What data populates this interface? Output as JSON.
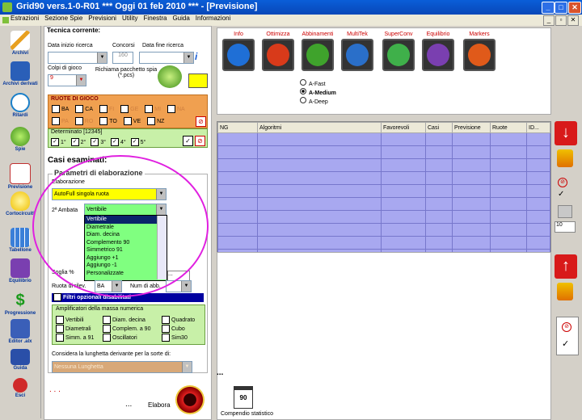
{
  "window": {
    "title": "Grid90 vers.1-0-R01  ***  Oggi 01 feb 2010  ***  - [Previsione]",
    "min_label": "_",
    "max_label": "□",
    "close_label": "✕"
  },
  "menu": {
    "items": [
      "Estrazioni",
      "Sezione Spie",
      "Previsioni",
      "Utility",
      "Finestra",
      "Guida",
      "Informazioni"
    ]
  },
  "toolbar": {
    "items": [
      "Archivi",
      "Archivi derivati",
      "Ritardi",
      "Spie",
      "Previsione",
      "Cortocircuiti",
      "Tabellone",
      "Equilibrio",
      "Progressione",
      "Editor .alx",
      "Guida",
      "Esci"
    ]
  },
  "tecnica": {
    "title": "Tecnica corrente:",
    "data_inizio_label": "Data inizio ricerca",
    "concorsi_label": "Concorsi",
    "concorsi_value": "160",
    "data_fine_label": "Data fine ricerca",
    "colpi_label": "Colpi di gioco",
    "colpi_value": "9",
    "richiama_label": "Richiama pacchetto spia (*.pcs)",
    "ruote_title": "RUOTE DI GIOCO",
    "ruote_row1": [
      "BA",
      "CA",
      "FI",
      "GE",
      "MI",
      "NA"
    ],
    "ruote_row2": [
      "PA",
      "RO",
      "TO",
      "VE",
      "NZ"
    ],
    "determinato_label": "Determinato [12345]",
    "determinato_items": [
      "1°",
      "2°",
      "3°",
      "4°",
      "5°"
    ]
  },
  "casi": {
    "title": "Casi esaminati:",
    "params_title": "Parametri di elaborazione",
    "elaborazione_label": "Elaborazione",
    "elaborazione_value": "AutoFull singola ruota",
    "ambata_label": "2ª Ambata",
    "ambata_value": "Vertibile",
    "ambata_options": [
      "Vertibile",
      "Diametrale",
      "Diam. decina",
      "Complemento 90",
      "Simmetrico 91",
      "Aggiungo +1",
      "Aggiungo -1",
      "Personalizzate"
    ],
    "soglia_label": "Soglia %",
    "ruota_label": "Ruota di rilev.",
    "ruota_value": "BA",
    "num_label": "Num di abb.",
    "filtri_label": "Filtri opzionali disabilitati",
    "amplificatori_title": "Amplificatori della massa numerica",
    "amplificatori": [
      "Vertibili",
      "Diam. decina",
      "Quadrato",
      "Diametrali",
      "Complem. a 90",
      "Cubo",
      "Simm. a 91",
      "Oscillatori",
      "Sim30"
    ],
    "lunghetta_label": "Considera la lunghetta derivante per la sorte di:",
    "lunghetta_value": "Nessuna Lunghetta",
    "dots": ". . .",
    "dots2": "...",
    "elabora_label": "Elabora"
  },
  "tools": {
    "buttons": [
      {
        "label": "Info",
        "color": "#1f6fd6"
      },
      {
        "label": "Ottimizza",
        "color": "#d83a1a"
      },
      {
        "label": "Abbinamenti",
        "color": "#3fa32c"
      },
      {
        "label": "MultiTek",
        "color": "#2a6fc9"
      },
      {
        "label": "SuperConv",
        "color": "#3fb04a"
      },
      {
        "label": "Equilibrio",
        "color": "#7a3fb0"
      },
      {
        "label": "Markers",
        "color": "#e05a1a"
      }
    ],
    "radio": [
      "A-Fast",
      "A-Medium",
      "A-Deep"
    ],
    "radio_selected": "A-Medium"
  },
  "grid": {
    "columns": [
      "NG",
      "Algoritmi",
      "Favorevoli",
      "Casi",
      "Previsione",
      "Ruote",
      "ID..."
    ],
    "dots": "..."
  },
  "compendio": {
    "label": "Compendio statistico",
    "calendar_num": "90"
  },
  "right": {
    "spin_value": "10"
  }
}
